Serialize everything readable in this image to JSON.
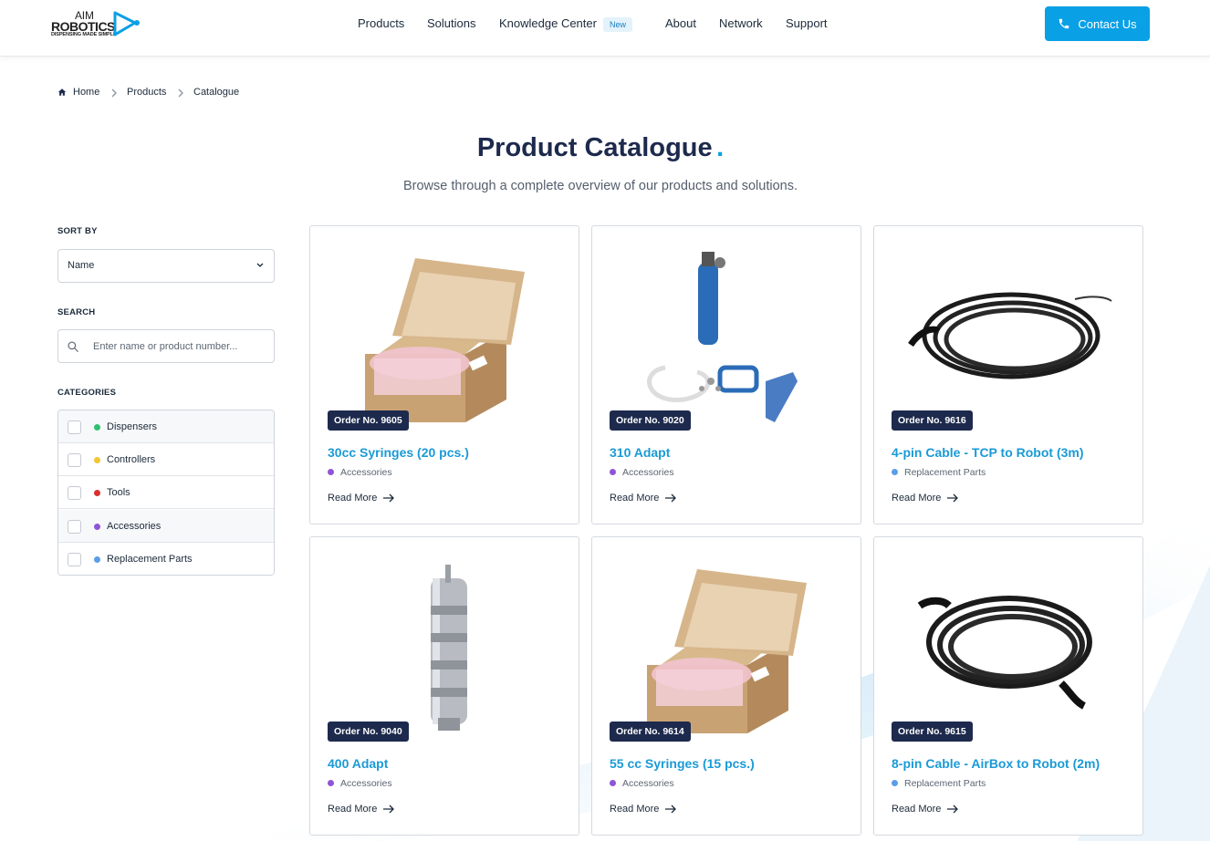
{
  "brand": {
    "line1": "AIM",
    "line2": "ROBOTICS",
    "tagline": "DISPENSING MADE SIMPLE"
  },
  "nav": {
    "items": [
      "Products",
      "Solutions",
      "Knowledge Center",
      "About",
      "Network",
      "Support"
    ],
    "new_badge": "New"
  },
  "contact": {
    "label": "Contact Us"
  },
  "breadcrumb": [
    "Home",
    "Products",
    "Catalogue"
  ],
  "page": {
    "title": "Product Catalogue",
    "title_dot": ".",
    "subtitle": "Browse through a complete overview of our products and solutions."
  },
  "sidebar": {
    "sort_label": "SORT BY",
    "sort_value": "Name",
    "search_label": "SEARCH",
    "search_placeholder": "Enter name or product number...",
    "categories_label": "CATEGORIES",
    "categories": [
      {
        "label": "Dispensers",
        "color": "#2fbf71"
      },
      {
        "label": "Controllers",
        "color": "#f2c533"
      },
      {
        "label": "Tools",
        "color": "#d93030"
      },
      {
        "label": "Accessories",
        "color": "#8e55d6"
      },
      {
        "label": "Replacement Parts",
        "color": "#5b9de8"
      }
    ]
  },
  "products": [
    {
      "order": "Order No. 9605",
      "name": "30cc Syringes (20 pcs.)",
      "category": "Accessories",
      "cat_color": "#8e55d6",
      "image": "box",
      "read_more": "Read More"
    },
    {
      "order": "Order No. 9020",
      "name": "310 Adapt",
      "category": "Accessories",
      "cat_color": "#8e55d6",
      "image": "adapter-kit",
      "read_more": "Read More"
    },
    {
      "order": "Order No. 9616",
      "name": "4-pin Cable - TCP to Robot (3m)",
      "category": "Replacement Parts",
      "cat_color": "#5b9de8",
      "image": "cable",
      "read_more": "Read More"
    },
    {
      "order": "Order No. 9040",
      "name": "400 Adapt",
      "category": "Accessories",
      "cat_color": "#8e55d6",
      "image": "cylinder",
      "read_more": "Read More"
    },
    {
      "order": "Order No. 9614",
      "name": "55 cc Syringes (15 pcs.)",
      "category": "Accessories",
      "cat_color": "#8e55d6",
      "image": "box",
      "read_more": "Read More"
    },
    {
      "order": "Order No. 9615",
      "name": "8-pin Cable - AirBox to Robot (2m)",
      "category": "Replacement Parts",
      "cat_color": "#5b9de8",
      "image": "cable",
      "read_more": "Read More"
    }
  ]
}
